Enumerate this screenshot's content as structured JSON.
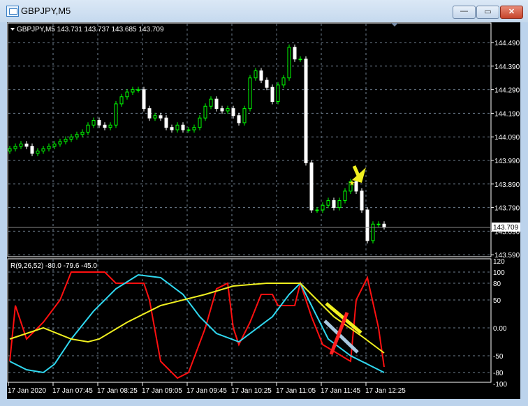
{
  "window": {
    "title": "GBPJPY,M5",
    "minimize_label": "—",
    "maximize_label": "▭",
    "close_label": "✕"
  },
  "chart_header": "GBPJPY,M5  143.731 143.737 143.685 143.709",
  "indicator_header": "R(9,26,52) -80.0 -79.6 -45.0",
  "current_price_label": "143.709",
  "colors": {
    "bull": "#00ff00",
    "bear": "#ffffff",
    "red": "#ff1010",
    "cyan": "#30d8f0",
    "yellow": "#f0f020",
    "grid": "#708090"
  },
  "chart_data": [
    {
      "type": "candlestick",
      "symbol": "GBPJPY",
      "timeframe": "M5",
      "ylim": [
        143.59,
        144.52
      ],
      "yticks": [
        "144.490",
        "144.390",
        "144.290",
        "144.190",
        "144.090",
        "143.990",
        "143.890",
        "143.790",
        "143.690",
        "143.590"
      ],
      "xticks": [
        "17 Jan 2020",
        "17 Jan 07:45",
        "17 Jan 08:25",
        "17 Jan 09:05",
        "17 Jan 09:45",
        "17 Jan 10:25",
        "17 Jan 11:05",
        "17 Jan 11:45",
        "17 Jan 12:25"
      ],
      "closes": [
        144.04,
        144.05,
        144.06,
        144.05,
        144.02,
        144.03,
        144.04,
        144.05,
        144.06,
        144.07,
        144.08,
        144.09,
        144.1,
        144.11,
        144.14,
        144.16,
        144.14,
        144.13,
        144.14,
        144.23,
        144.26,
        144.28,
        144.29,
        144.29,
        144.21,
        144.17,
        144.18,
        144.17,
        144.13,
        144.12,
        144.14,
        144.12,
        144.12,
        144.13,
        144.17,
        144.22,
        144.25,
        144.21,
        144.2,
        144.21,
        144.18,
        144.15,
        144.21,
        144.34,
        144.37,
        144.33,
        144.3,
        144.24,
        144.31,
        144.34,
        144.47,
        144.42,
        144.42,
        143.98,
        143.78,
        143.78,
        143.8,
        143.82,
        143.79,
        143.82,
        143.86,
        143.9,
        143.86,
        143.78,
        143.65,
        143.72,
        143.72,
        143.709
      ]
    },
    {
      "type": "line",
      "title": "R(9,26,52)",
      "ylim": [
        -100,
        120
      ],
      "yticks": [
        "120",
        "100",
        "80",
        "50",
        "0.00",
        "-50",
        "-80",
        "-100"
      ],
      "series": [
        {
          "name": "R9",
          "color": "#ff1010",
          "x": [
            0,
            1,
            3,
            6,
            9,
            11,
            17,
            19,
            24,
            25,
            27,
            30,
            32,
            35,
            37,
            39,
            40,
            41,
            43,
            45,
            47,
            48,
            51,
            52,
            54,
            56,
            61,
            62,
            64,
            66,
            67
          ],
          "values": [
            -60,
            40,
            -20,
            10,
            50,
            100,
            100,
            80,
            80,
            50,
            -60,
            -90,
            -80,
            0,
            70,
            80,
            0,
            -30,
            10,
            60,
            60,
            40,
            40,
            80,
            20,
            -30,
            -60,
            50,
            90,
            0,
            -70
          ]
        },
        {
          "name": "R26",
          "color": "#30d8f0",
          "x": [
            0,
            3,
            6,
            8,
            11,
            15,
            19,
            23,
            27,
            31,
            34,
            37,
            41,
            47,
            50,
            52,
            54,
            57,
            61,
            67
          ],
          "values": [
            -60,
            -75,
            -80,
            -65,
            -20,
            30,
            70,
            95,
            90,
            60,
            20,
            -10,
            -25,
            20,
            60,
            80,
            40,
            -20,
            -50,
            -80
          ]
        },
        {
          "name": "R52",
          "color": "#f0f020",
          "x": [
            0,
            6,
            11,
            14,
            16,
            21,
            27,
            35,
            40,
            46,
            52,
            55,
            58,
            63,
            67
          ],
          "values": [
            -20,
            0,
            -20,
            -25,
            -20,
            10,
            40,
            60,
            75,
            80,
            80,
            50,
            20,
            -15,
            -45
          ]
        }
      ]
    }
  ]
}
